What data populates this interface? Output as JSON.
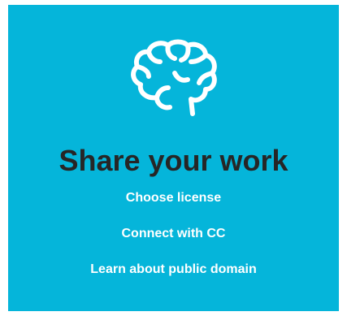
{
  "card": {
    "background": "#05b5da",
    "icon": "brain-icon",
    "title": "Share your work",
    "title_color": "#262626",
    "links": [
      {
        "label": "Choose license"
      },
      {
        "label": "Connect with CC"
      },
      {
        "label": "Learn about public domain"
      }
    ],
    "link_color": "#ffffff"
  }
}
